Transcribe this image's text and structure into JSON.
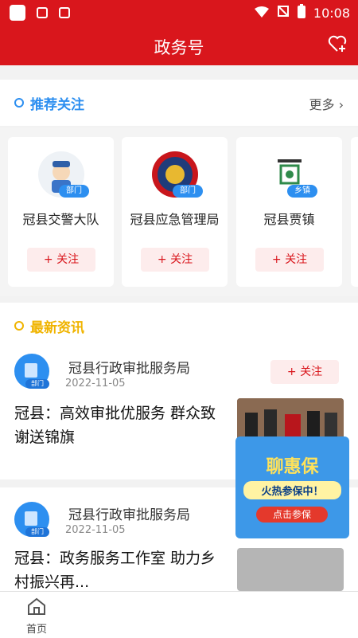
{
  "status_bar": {
    "time": "10:08"
  },
  "header": {
    "title": "政务号"
  },
  "recommend": {
    "title": "推荐关注",
    "more": "更多",
    "accounts": [
      {
        "name": "冠县交警大队",
        "tag": "部门",
        "follow": "+ 关注"
      },
      {
        "name": "冠县应急管理局",
        "tag": "部门",
        "follow": "+ 关注"
      },
      {
        "name": "冠县贾镇",
        "tag": "乡镇",
        "follow": "+ 关注"
      }
    ]
  },
  "latest": {
    "title": "最新资讯",
    "items": [
      {
        "source": "冠县行政审批服务局",
        "tag": "部门",
        "date": "2022-11-05",
        "follow": "+ 关注",
        "headline": "冠县：高效审批优服务 群众致谢送锦旗"
      },
      {
        "source": "冠县行政审批服务局",
        "tag": "部门",
        "date": "2022-11-05",
        "headline": "冠县：政务服务工作室 助力乡村振兴再..."
      }
    ]
  },
  "ad": {
    "title": "聊惠保",
    "subtitle": "火热参保中！",
    "button": "点击参保"
  },
  "tabbar": {
    "home": "首页"
  },
  "colors": {
    "brand_red": "#d9161c",
    "accent_blue": "#2d8ff0",
    "accent_yellow": "#f0b400"
  }
}
